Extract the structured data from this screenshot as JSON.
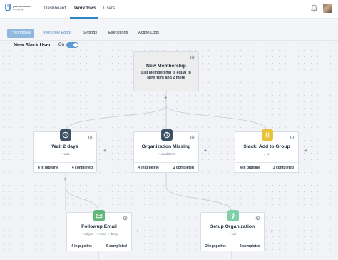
{
  "brand": {
    "line1": "your awesome",
    "line2": "company"
  },
  "nav": {
    "items": [
      {
        "label": "Dashboard"
      },
      {
        "label": "Workflows",
        "active": true
      },
      {
        "label": "Users"
      }
    ]
  },
  "tabs": {
    "back_label": "Workflows",
    "items": [
      {
        "label": "Workflow Editor",
        "current": true
      },
      {
        "label": "Settings"
      },
      {
        "label": "Executions"
      },
      {
        "label": "Action Logs"
      }
    ]
  },
  "workflow": {
    "name": "New Slack User",
    "status_label": "On",
    "enabled": true
  },
  "colors": {
    "accent": "#5b9ad5",
    "wait": "#3e5063",
    "question": "#3e5063",
    "slack": "#e8c13a",
    "email": "#63b77b",
    "setup": "#7fd0a9"
  },
  "nodes": {
    "membership": {
      "title": "New Membership",
      "desc_line1": "List Membership is equal to",
      "desc_line2": "New York and 2 more"
    },
    "wait": {
      "title": "Wait 2 days",
      "tag": "wait",
      "pipeline": "8 in pipeline",
      "completed": "4 completed",
      "icon": "clock-icon"
    },
    "missing": {
      "title": "Organization Missing",
      "tag": "conditions",
      "pipeline": "4 in pipeline",
      "completed": "2 completed",
      "icon": "question-icon"
    },
    "slack": {
      "title": "Slack: Add to Group",
      "tag": "url",
      "pipeline": "4 in pipeline",
      "completed": "3 completed",
      "icon": "hash-icon"
    },
    "email": {
      "title": "Followup Email",
      "tags": [
        "subject",
        "email",
        "body"
      ],
      "pipeline": "4 in pipeline",
      "completed": "0 completed",
      "icon": "mail-icon"
    },
    "setup": {
      "title": "Setup Organization",
      "tag": "url",
      "pipeline": "2 in pipeline",
      "completed": "2 completed",
      "icon": "bolt-icon"
    }
  },
  "add_symbol": "+"
}
